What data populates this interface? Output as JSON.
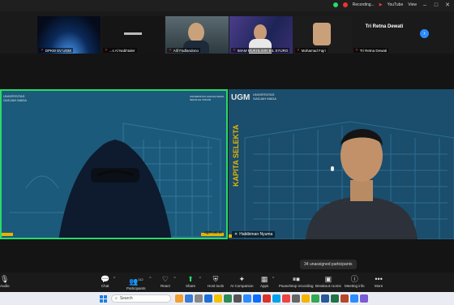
{
  "topbar": {
    "recording_label": "Recording...",
    "youtube_label": "YouTube",
    "view_label": "View"
  },
  "thumbnails": [
    {
      "name": "DPKM SV UGM",
      "bg": "#0b1c3a"
    },
    {
      "name": "...s Al Nabhtaler",
      "bg": "#1a1a1a"
    },
    {
      "name": "Alif Fadlandono",
      "bg": "#3b4a52"
    },
    {
      "name": "IMAM MUKHLISIN BIL SYURO",
      "bg": "#2a2f6a"
    },
    {
      "name": "Mohamad Fajri",
      "bg": "#222"
    },
    {
      "name": "Tri Retna Dewati",
      "bg": "#1a1a1a"
    }
  ],
  "thumb_big_name": "Tri Retna Dewati",
  "tiles": {
    "left": {
      "name": "ugm.ac.id",
      "logo_text": "UNIVERSITAS GADJAH MADA",
      "top_right_text": "UNIVERSITAS GADJAH MADA\nSEKOLAH VOKASI"
    },
    "right": {
      "name": "Habibiman Nyuma",
      "logo_text": "UGM",
      "logo_sub": "UNIVERSITAS GADJAH MADA",
      "side_text": "KAPITA SELEKTA"
    }
  },
  "unassigned": "34 unassigned participants",
  "toolbar": {
    "audio": "Audio",
    "chat": "Chat",
    "participants": "Participants",
    "participants_count": "112",
    "react": "React",
    "share": "Share",
    "host_tools": "Host tools",
    "ai_companion": "AI Companion",
    "apps": "Apps",
    "pause_recording": "Pause/stop recording",
    "breakout_rooms": "Breakout rooms",
    "meeting_info": "Meeting info",
    "more": "More"
  },
  "taskbar": {
    "search_placeholder": "Search"
  },
  "colors": {
    "accent_green": "#2bd96a",
    "ugm_blue": "#1b4d6c",
    "zoom_blue": "#2d8cff",
    "highlight_yellow": "#e6b400"
  }
}
